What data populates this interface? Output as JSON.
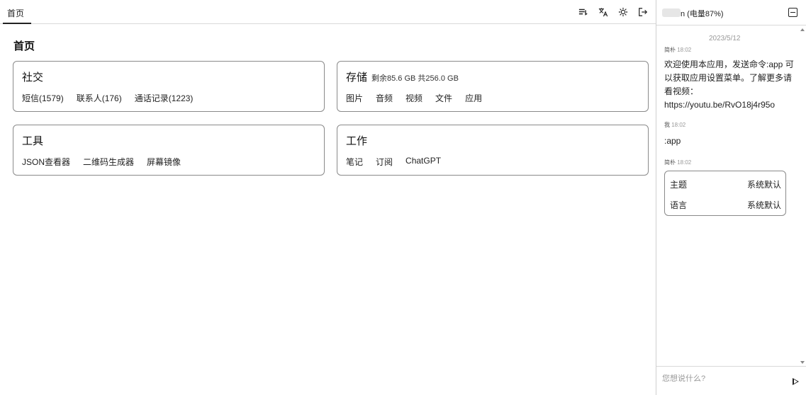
{
  "topbar": {
    "tab_home": "首页",
    "icons": [
      "playlist-icon",
      "translate-icon",
      "brightness-icon",
      "logout-icon"
    ]
  },
  "page": {
    "title": "首页"
  },
  "cards": {
    "social": {
      "title": "社交",
      "links": [
        "短信(1579)",
        "联系人(176)",
        "通话记录(1223)"
      ]
    },
    "storage": {
      "title": "存储",
      "subtitle": "剩余85.6 GB 共256.0 GB",
      "links": [
        "图片",
        "音频",
        "视频",
        "文件",
        "应用"
      ]
    },
    "tools": {
      "title": "工具",
      "links": [
        "JSON查看器",
        "二维码生成器",
        "屏幕镜像"
      ]
    },
    "work": {
      "title": "工作",
      "links": [
        "笔记",
        "订阅",
        "ChatGPT"
      ]
    }
  },
  "chat": {
    "header_title": "n (电量87%)",
    "date": "2023/5/12",
    "messages": [
      {
        "sender": "简朴",
        "time": "18:02",
        "text": "欢迎使用本应用，发送命令:app 可以获取应用设置菜单。了解更多请看视频：https://youtu.be/RvO18j4r95o"
      },
      {
        "sender": "我",
        "time": "18:02",
        "text": ":app"
      },
      {
        "sender": "简朴",
        "time": "18:02"
      }
    ],
    "settings": [
      {
        "label": "主题",
        "value": "系统默认"
      },
      {
        "label": "语言",
        "value": "系统默认"
      }
    ],
    "input_placeholder": "您想说什么?"
  }
}
